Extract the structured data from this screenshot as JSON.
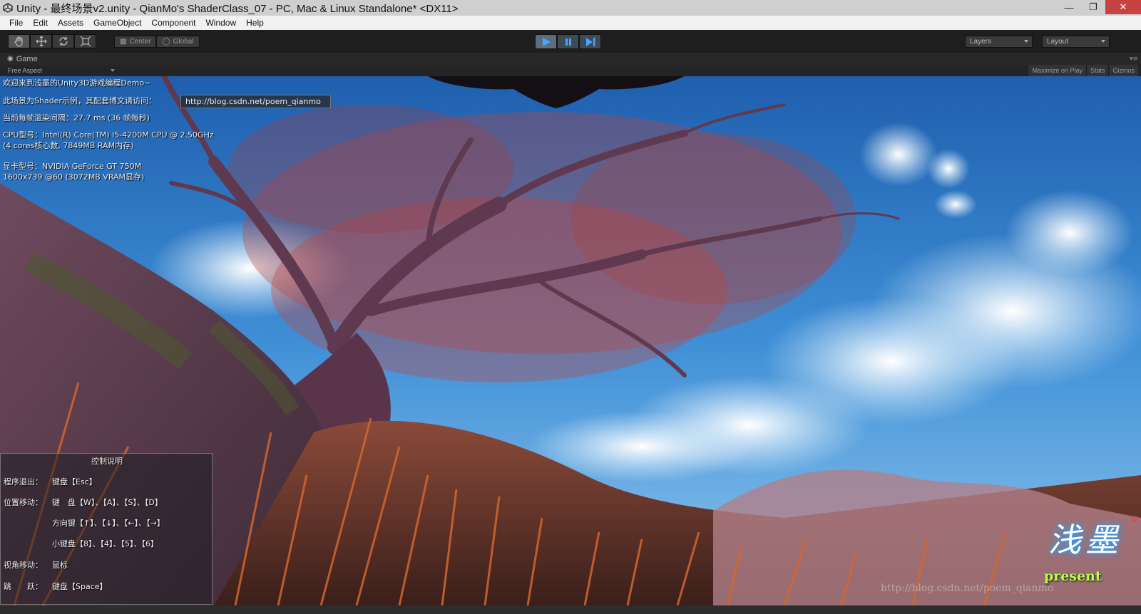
{
  "window": {
    "title": "Unity - 最终场景v2.unity - QianMo's ShaderClass_07 - PC, Mac & Linux Standalone* <DX11>",
    "controls": [
      "minimize",
      "restore",
      "close"
    ]
  },
  "menu": [
    "File",
    "Edit",
    "Assets",
    "GameObject",
    "Component",
    "Window",
    "Help"
  ],
  "toolbar": {
    "tools": [
      "hand-icon",
      "move-icon",
      "rotate-icon",
      "scale-icon"
    ],
    "pivot": "Center",
    "space": "Global",
    "play_controls": [
      "play-icon",
      "pause-icon",
      "step-icon"
    ],
    "layers": "Layers",
    "layout": "Layout"
  },
  "game_view": {
    "tab": "Game",
    "aspect": "Free Aspect",
    "maximize_on_play": "Maximize on Play",
    "stats": "Stats",
    "gizmos": "Gizmos"
  },
  "overlay": {
    "welcome": "欢迎来到浅墨的Unity3D游戏编程Demo~",
    "blog_prompt": "此场景为Shader示例，其配套博文请访问：",
    "blog_url": "http://blog.csdn.net/poem_qianmo",
    "frame_time": "当前每帧渲染间隔：27.7 ms (36 帧每秒)",
    "cpu": "CPU型号：Intel(R) Core(TM) i5-4200M CPU @ 2.50GHz",
    "cpu_detail": "(4 cores核心数, 7849MB RAM内存)",
    "gpu": "显卡型号：NVIDIA GeForce GT 750M",
    "gpu_detail": "1600x739 @60 (3072MB VRAM显存)"
  },
  "controls_panel": {
    "title": "控制说明",
    "exit_label": "程序退出：",
    "exit_value": "键盘【Esc】",
    "move_label": "位置移动：",
    "move_keys": "键　盘【W】、【A】、【S】、【D】",
    "move_arrows": "方向键【↑】、【↓】、【←】、【→】",
    "move_numpad": "小键盘【8】、【4】、【5】、【6】",
    "view_label": "视角移动：",
    "view_value": "鼠标",
    "jump_label": "跳　　跃：",
    "jump_value": "键盘【Space】"
  },
  "logo": {
    "text": "浅墨",
    "subtitle": "present"
  },
  "watermark": "http://blog.csdn.net/poem_qianmo",
  "colors": {
    "sky": "#3f8fd6",
    "foliage": "#c8433a",
    "trunk": "#6b3f55",
    "play_accent": "#4aa3ff"
  }
}
